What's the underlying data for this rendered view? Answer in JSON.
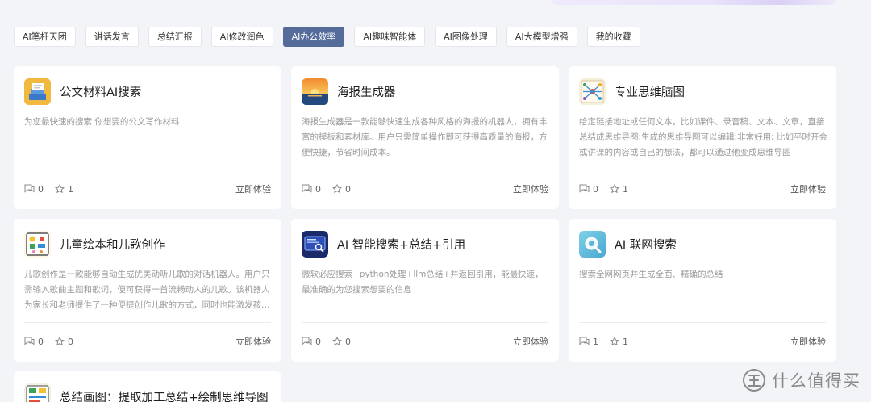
{
  "tabs": [
    {
      "label": "AI笔杆天团",
      "active": false
    },
    {
      "label": "讲话发言",
      "active": false
    },
    {
      "label": "总结汇报",
      "active": false
    },
    {
      "label": "AI修改润色",
      "active": false
    },
    {
      "label": "AI办公效率",
      "active": true
    },
    {
      "label": "AI趣味智能体",
      "active": false
    },
    {
      "label": "AI图像处理",
      "active": false
    },
    {
      "label": "AI大模型增强",
      "active": false
    },
    {
      "label": "我的收藏",
      "active": false
    }
  ],
  "cards": [
    {
      "title": "公文材料AI搜索",
      "desc": "为您最快速的搜索 你想要的公文写作材料",
      "comments": "0",
      "likes": "1",
      "action": "立即体验",
      "icon": "document-stack-icon"
    },
    {
      "title": "海报生成器",
      "desc": "海报生成器是一款能够快速生成各种风格的海报的机器人，拥有丰富的模板和素材库。用户只需简单操作即可获得高质量的海报，方便快捷，节省时间成本。",
      "comments": "0",
      "likes": "0",
      "action": "立即体验",
      "icon": "sunset-poster-icon"
    },
    {
      "title": "专业思维脑图",
      "desc": "给定链接地址或任何文本，比如课件、录音稿、文本、文章，直接总结成思维导图;生成的思维导图可以编辑;非常好用; 比如平时开会或讲课的内容或自己的想法，都可以通过他变成思维导图",
      "comments": "0",
      "likes": "1",
      "action": "立即体验",
      "icon": "mind-map-icon"
    },
    {
      "title": "儿童绘本和儿歌创作",
      "desc": "儿歌创作是一款能够自动生成优美动听儿歌的对话机器人。用户只需输入歌曲主题和歌词，便可获得一首流畅动人的儿歌。该机器人为家长和老师提供了一种便捷创作儿歌的方式，同时也能激发孩子们的音乐兴趣",
      "comments": "0",
      "likes": "0",
      "action": "立即体验",
      "icon": "picture-book-icon"
    },
    {
      "title": "AI 智能搜索+总结+引用",
      "desc": "微软必应搜索+python处理+llm总结+并返回引用，能最快速，最准确的为您搜索想要的信息",
      "comments": "0",
      "likes": "0",
      "action": "立即体验",
      "icon": "smart-search-icon"
    },
    {
      "title": "AI 联网搜索",
      "desc": "搜索全网网页并生成全面、精确的总结",
      "comments": "1",
      "likes": "1",
      "action": "立即体验",
      "icon": "web-search-icon"
    },
    {
      "title": "总结画图：提取加工总结+绘制思维导图",
      "desc": "",
      "comments": "",
      "likes": "",
      "action": "",
      "icon": "summary-draw-icon"
    }
  ],
  "watermark": {
    "text": "什么值得买",
    "logo": "smzdm-logo"
  }
}
